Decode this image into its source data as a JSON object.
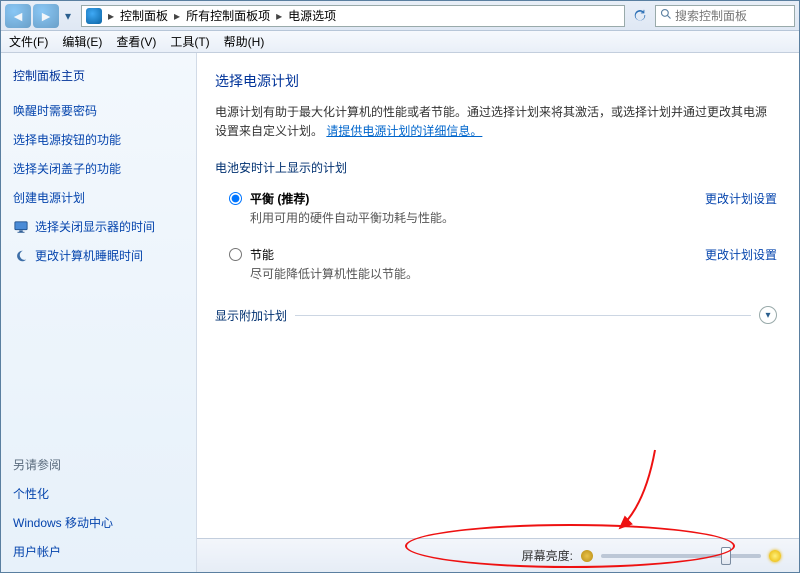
{
  "address": {
    "segments": [
      "控制面板",
      "所有控制面板项",
      "电源选项"
    ],
    "search_placeholder": "搜索控制面板"
  },
  "menu": {
    "items": [
      "文件(F)",
      "编辑(E)",
      "查看(V)",
      "工具(T)",
      "帮助(H)"
    ]
  },
  "sidebar": {
    "home": "控制面板主页",
    "links": [
      {
        "label": "唤醒时需要密码",
        "icon": ""
      },
      {
        "label": "选择电源按钮的功能",
        "icon": ""
      },
      {
        "label": "选择关闭盖子的功能",
        "icon": ""
      },
      {
        "label": "创建电源计划",
        "icon": ""
      },
      {
        "label": "选择关闭显示器的时间",
        "icon": "monitor"
      },
      {
        "label": "更改计算机睡眠时间",
        "icon": "moon"
      }
    ],
    "see_also_head": "另请参阅",
    "see_also": [
      "个性化",
      "Windows 移动中心",
      "用户帐户"
    ]
  },
  "main": {
    "title": "选择电源计划",
    "desc_pre": "电源计划有助于最大化计算机的性能或者节能。通过选择计划来将其激活，或选择计划并通过更改其电源设置来自定义计划。",
    "desc_link": "请提供电源计划的详细信息。",
    "group1": "电池安时计上显示的计划",
    "change_label": "更改计划设置",
    "plans": [
      {
        "name": "平衡 (推荐)",
        "desc": "利用可用的硬件自动平衡功耗与性能。",
        "selected": true
      },
      {
        "name": "节能",
        "desc": "尽可能降低计算机性能以节能。",
        "selected": false
      }
    ],
    "expand_label": "显示附加计划"
  },
  "bottom": {
    "brightness_label": "屏幕亮度:",
    "brightness_value": 80
  }
}
